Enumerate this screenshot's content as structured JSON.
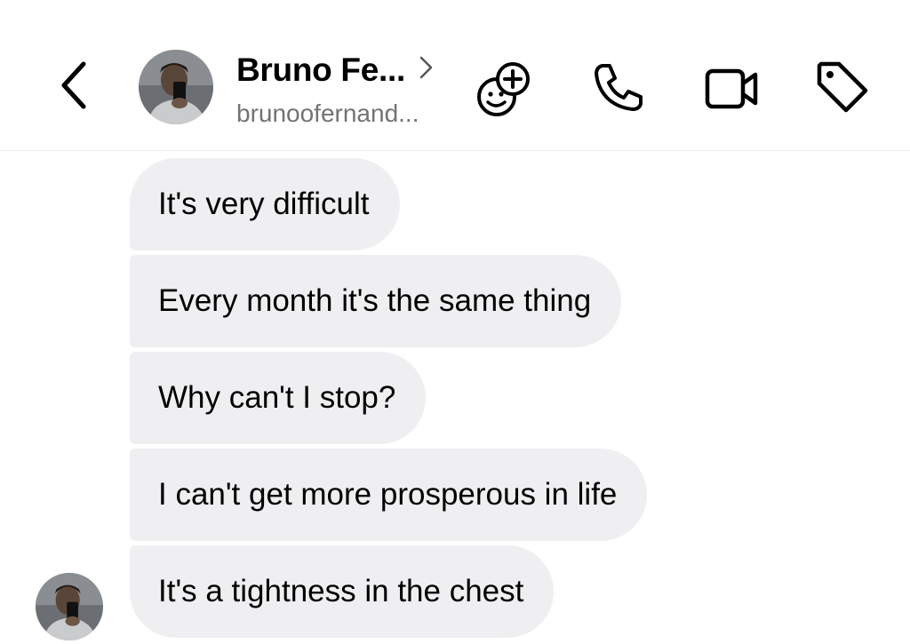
{
  "header": {
    "contact_name": "Bruno Fe...",
    "contact_username": "brunoofernand...",
    "icons": {
      "back": "chevron-left-icon",
      "profile": "chevron-right-icon",
      "effects": "smiley-plus-icon",
      "call": "phone-icon",
      "video": "video-camera-icon",
      "tag": "tag-icon"
    }
  },
  "messages": [
    {
      "text": "It's very difficult"
    },
    {
      "text": "Every month it's the same thing"
    },
    {
      "text": "Why can't I stop?"
    },
    {
      "text": "I can't get more prosperous in life"
    },
    {
      "text": "It's a tightness in the chest"
    }
  ],
  "colors": {
    "bubble_bg": "#efeff1",
    "username_gray": "#737373",
    "icon_color": "#000000"
  }
}
